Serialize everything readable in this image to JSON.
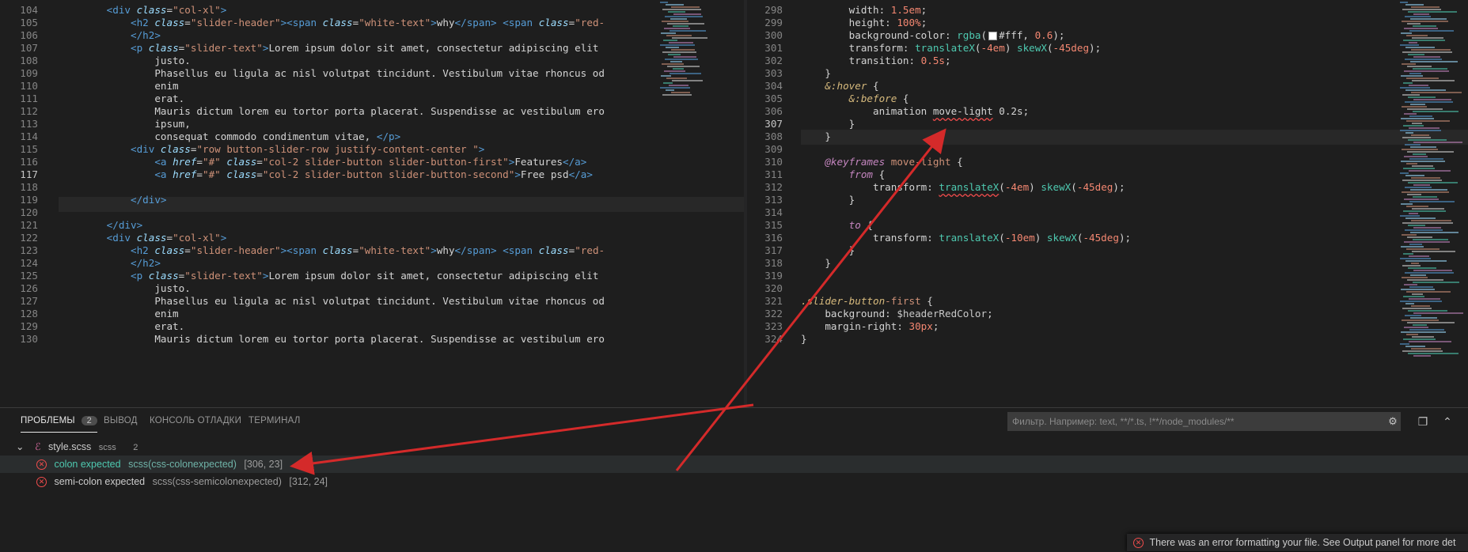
{
  "left_editor": {
    "lines": [
      {
        "n": "104",
        "parts": [
          [
            "txt",
            "        "
          ],
          [
            "tag",
            "<div "
          ],
          [
            "attr",
            "class"
          ],
          [
            "txt",
            "="
          ],
          [
            "str",
            "\"col-xl\""
          ],
          [
            "tag",
            ">"
          ]
        ]
      },
      {
        "n": "105",
        "parts": [
          [
            "txt",
            "            "
          ],
          [
            "tag",
            "<h2 "
          ],
          [
            "attr",
            "class"
          ],
          [
            "txt",
            "="
          ],
          [
            "str",
            "\"slider-header\""
          ],
          [
            "tag",
            "><span "
          ],
          [
            "attr",
            "class"
          ],
          [
            "txt",
            "="
          ],
          [
            "str",
            "\"white-text\""
          ],
          [
            "tag",
            ">"
          ],
          [
            "txt",
            "why"
          ],
          [
            "tag",
            "</span> <span "
          ],
          [
            "attr",
            "class"
          ],
          [
            "txt",
            "="
          ],
          [
            "str",
            "\"red-"
          ]
        ]
      },
      {
        "n": "106",
        "parts": [
          [
            "txt",
            "            "
          ],
          [
            "tag",
            "</h2>"
          ]
        ]
      },
      {
        "n": "107",
        "parts": [
          [
            "txt",
            "            "
          ],
          [
            "tag",
            "<p "
          ],
          [
            "attr",
            "class"
          ],
          [
            "txt",
            "="
          ],
          [
            "str",
            "\"slider-text\""
          ],
          [
            "tag",
            ">"
          ],
          [
            "txt",
            "Lorem ipsum dolor sit amet, consectetur adipiscing elit"
          ]
        ]
      },
      {
        "n": "108",
        "parts": [
          [
            "txt",
            "                justo."
          ]
        ]
      },
      {
        "n": "109",
        "parts": [
          [
            "txt",
            "                Phasellus eu ligula ac nisl volutpat tincidunt. Vestibulum vitae rhoncus od"
          ]
        ]
      },
      {
        "n": "110",
        "parts": [
          [
            "txt",
            "                enim"
          ]
        ]
      },
      {
        "n": "111",
        "parts": [
          [
            "txt",
            "                erat."
          ]
        ]
      },
      {
        "n": "112",
        "parts": [
          [
            "txt",
            "                Mauris dictum lorem eu tortor porta placerat. Suspendisse ac vestibulum ero"
          ]
        ]
      },
      {
        "n": "113",
        "parts": [
          [
            "txt",
            "                ipsum,"
          ]
        ]
      },
      {
        "n": "114",
        "parts": [
          [
            "txt",
            "                consequat commodo condimentum vitae, "
          ],
          [
            "tag",
            "</p>"
          ]
        ]
      },
      {
        "n": "115",
        "parts": [
          [
            "txt",
            "            "
          ],
          [
            "tag",
            "<div "
          ],
          [
            "attr",
            "class"
          ],
          [
            "txt",
            "="
          ],
          [
            "str",
            "\"row button-slider-row justify-content-center \""
          ],
          [
            "tag",
            ">"
          ]
        ]
      },
      {
        "n": "116",
        "parts": [
          [
            "txt",
            "                "
          ],
          [
            "tag",
            "<a "
          ],
          [
            "attr",
            "href"
          ],
          [
            "txt",
            "="
          ],
          [
            "str",
            "\"#\""
          ],
          [
            "txt",
            " "
          ],
          [
            "attr",
            "class"
          ],
          [
            "txt",
            "="
          ],
          [
            "str",
            "\"col-2 slider-button slider-button-first\""
          ],
          [
            "tag",
            ">"
          ],
          [
            "txt",
            "Features"
          ],
          [
            "tag",
            "</a>"
          ]
        ]
      },
      {
        "n": "117",
        "parts": [
          [
            "txt",
            "                "
          ],
          [
            "tag",
            "<a "
          ],
          [
            "attr",
            "href"
          ],
          [
            "txt",
            "="
          ],
          [
            "str",
            "\"#\""
          ],
          [
            "txt",
            " "
          ],
          [
            "attr",
            "class"
          ],
          [
            "txt",
            "="
          ],
          [
            "str",
            "\"col-2 slider-button slider-button-second\""
          ],
          [
            "tag",
            ">"
          ],
          [
            "txt",
            "Free psd"
          ],
          [
            "tag",
            "</a>"
          ]
        ]
      },
      {
        "n": "118",
        "parts": []
      },
      {
        "n": "119",
        "parts": [
          [
            "txt",
            "            "
          ],
          [
            "tag",
            "</div>"
          ]
        ]
      },
      {
        "n": "120",
        "parts": []
      },
      {
        "n": "121",
        "parts": [
          [
            "txt",
            "        "
          ],
          [
            "tag",
            "</div>"
          ]
        ]
      },
      {
        "n": "122",
        "parts": [
          [
            "txt",
            "        "
          ],
          [
            "tag",
            "<div "
          ],
          [
            "attr",
            "class"
          ],
          [
            "txt",
            "="
          ],
          [
            "str",
            "\"col-xl\""
          ],
          [
            "tag",
            ">"
          ]
        ]
      },
      {
        "n": "123",
        "parts": [
          [
            "txt",
            "            "
          ],
          [
            "tag",
            "<h2 "
          ],
          [
            "attr",
            "class"
          ],
          [
            "txt",
            "="
          ],
          [
            "str",
            "\"slider-header\""
          ],
          [
            "tag",
            "><span "
          ],
          [
            "attr",
            "class"
          ],
          [
            "txt",
            "="
          ],
          [
            "str",
            "\"white-text\""
          ],
          [
            "tag",
            ">"
          ],
          [
            "txt",
            "why"
          ],
          [
            "tag",
            "</span> <span "
          ],
          [
            "attr",
            "class"
          ],
          [
            "txt",
            "="
          ],
          [
            "str",
            "\"red-"
          ]
        ]
      },
      {
        "n": "124",
        "parts": [
          [
            "txt",
            "            "
          ],
          [
            "tag",
            "</h2>"
          ]
        ]
      },
      {
        "n": "125",
        "parts": [
          [
            "txt",
            "            "
          ],
          [
            "tag",
            "<p "
          ],
          [
            "attr",
            "class"
          ],
          [
            "txt",
            "="
          ],
          [
            "str",
            "\"slider-text\""
          ],
          [
            "tag",
            ">"
          ],
          [
            "txt",
            "Lorem ipsum dolor sit amet, consectetur adipiscing elit"
          ]
        ]
      },
      {
        "n": "126",
        "parts": [
          [
            "txt",
            "                justo."
          ]
        ]
      },
      {
        "n": "127",
        "parts": [
          [
            "txt",
            "                Phasellus eu ligula ac nisl volutpat tincidunt. Vestibulum vitae rhoncus od"
          ]
        ]
      },
      {
        "n": "128",
        "parts": [
          [
            "txt",
            "                enim"
          ]
        ]
      },
      {
        "n": "129",
        "parts": [
          [
            "txt",
            "                erat."
          ]
        ]
      },
      {
        "n": "130",
        "parts": [
          [
            "txt",
            "                Mauris dictum lorem eu tortor porta placerat. Suspendisse ac vestibulum ero"
          ]
        ]
      }
    ],
    "active_line": "117"
  },
  "right_editor": {
    "lines": [
      {
        "n": "298",
        "parts": [
          [
            "txt",
            "        "
          ],
          [
            "prop",
            "width: "
          ],
          [
            "num",
            "1.5em"
          ],
          [
            "txt",
            ";"
          ]
        ]
      },
      {
        "n": "299",
        "parts": [
          [
            "txt",
            "        "
          ],
          [
            "prop",
            "height: "
          ],
          [
            "num",
            "100%"
          ],
          [
            "txt",
            ";"
          ]
        ]
      },
      {
        "n": "300",
        "parts": [
          [
            "txt",
            "        "
          ],
          [
            "prop",
            "background-color: "
          ],
          [
            "fn",
            "rgba"
          ],
          [
            "txt",
            "("
          ],
          [
            "swatch",
            ""
          ],
          [
            "txt",
            "#fff, "
          ],
          [
            "num",
            "0.6"
          ],
          [
            "txt",
            ");"
          ]
        ]
      },
      {
        "n": "301",
        "parts": [
          [
            "txt",
            "        "
          ],
          [
            "prop",
            "transform: "
          ],
          [
            "fn",
            "translateX"
          ],
          [
            "txt",
            "("
          ],
          [
            "num",
            "-4em"
          ],
          [
            "txt",
            ") "
          ],
          [
            "fn",
            "skewX"
          ],
          [
            "txt",
            "("
          ],
          [
            "num",
            "-45deg"
          ],
          [
            "txt",
            ");"
          ]
        ]
      },
      {
        "n": "302",
        "parts": [
          [
            "txt",
            "        "
          ],
          [
            "prop",
            "transition: "
          ],
          [
            "num",
            "0.5s"
          ],
          [
            "txt",
            ";"
          ]
        ]
      },
      {
        "n": "303",
        "parts": [
          [
            "txt",
            "    }"
          ]
        ]
      },
      {
        "n": "304",
        "parts": [
          [
            "txt",
            "    "
          ],
          [
            "sel",
            "&:hover"
          ],
          [
            "txt",
            " {"
          ]
        ]
      },
      {
        "n": "305",
        "parts": [
          [
            "txt",
            "        "
          ],
          [
            "sel",
            "&:before"
          ],
          [
            "txt",
            " {"
          ]
        ]
      },
      {
        "n": "306",
        "parts": [
          [
            "txt",
            "            "
          ],
          [
            "prop",
            "animation "
          ],
          [
            "errstr",
            "move-light"
          ],
          [
            "txt",
            " 0.2s;"
          ]
        ]
      },
      {
        "n": "307",
        "parts": [
          [
            "txt",
            "        }"
          ]
        ]
      },
      {
        "n": "308",
        "parts": [
          [
            "txt",
            "    }"
          ]
        ]
      },
      {
        "n": "309",
        "parts": []
      },
      {
        "n": "310",
        "parts": [
          [
            "txt",
            "    "
          ],
          [
            "kw",
            "@keyframes"
          ],
          [
            "txt",
            " "
          ],
          [
            "str",
            "move-light"
          ],
          [
            "txt",
            " {"
          ]
        ]
      },
      {
        "n": "311",
        "parts": [
          [
            "txt",
            "        "
          ],
          [
            "kw",
            "from"
          ],
          [
            "txt",
            " {"
          ]
        ]
      },
      {
        "n": "312",
        "parts": [
          [
            "txt",
            "            "
          ],
          [
            "prop",
            "transform: "
          ],
          [
            "errfn",
            "translateX"
          ],
          [
            "txt",
            "("
          ],
          [
            "num",
            "-4em"
          ],
          [
            "txt",
            ") "
          ],
          [
            "fn",
            "skewX"
          ],
          [
            "txt",
            "("
          ],
          [
            "num",
            "-45deg"
          ],
          [
            "txt",
            ");"
          ]
        ]
      },
      {
        "n": "313",
        "parts": [
          [
            "txt",
            "        }"
          ]
        ]
      },
      {
        "n": "314",
        "parts": []
      },
      {
        "n": "315",
        "parts": [
          [
            "txt",
            "        "
          ],
          [
            "kw",
            "to"
          ],
          [
            "txt",
            " {"
          ]
        ]
      },
      {
        "n": "316",
        "parts": [
          [
            "txt",
            "            "
          ],
          [
            "prop",
            "transform: "
          ],
          [
            "fn",
            "translateX"
          ],
          [
            "txt",
            "("
          ],
          [
            "num",
            "-10em"
          ],
          [
            "txt",
            ") "
          ],
          [
            "fn",
            "skewX"
          ],
          [
            "txt",
            "("
          ],
          [
            "num",
            "-45deg"
          ],
          [
            "txt",
            ");"
          ]
        ]
      },
      {
        "n": "317",
        "parts": [
          [
            "txt",
            "        }"
          ]
        ]
      },
      {
        "n": "318",
        "parts": [
          [
            "txt",
            "    }"
          ]
        ]
      },
      {
        "n": "319",
        "parts": []
      },
      {
        "n": "320",
        "parts": []
      },
      {
        "n": "321",
        "parts": [
          [
            "sel",
            ".slider-button"
          ],
          [
            "str",
            "-first"
          ],
          [
            "txt",
            " {"
          ]
        ]
      },
      {
        "n": "322",
        "parts": [
          [
            "txt",
            "    "
          ],
          [
            "prop",
            "background: "
          ],
          [
            "var",
            "$headerRedColor"
          ],
          [
            "txt",
            ";"
          ]
        ]
      },
      {
        "n": "323",
        "parts": [
          [
            "txt",
            "    "
          ],
          [
            "prop",
            "margin-right: "
          ],
          [
            "num",
            "30px"
          ],
          [
            "txt",
            ";"
          ]
        ]
      },
      {
        "n": "324",
        "parts": [
          [
            "txt",
            "}"
          ]
        ]
      }
    ],
    "active_line": "307"
  },
  "panel": {
    "tabs": [
      {
        "label": "ПРОБЛЕМЫ",
        "badge": "2"
      },
      {
        "label": "ВЫВОД"
      },
      {
        "label": "КОНСОЛЬ ОТЛАДКИ"
      },
      {
        "label": "ТЕРМИНАЛ"
      }
    ],
    "filter_placeholder": "Фильтр. Например: text, **/*.ts, !**/node_modules/**",
    "file": {
      "name": "style.scss",
      "lang": "scss",
      "count": "2"
    },
    "problems": [
      {
        "message": "colon expected",
        "source": "scss(css-colonexpected)",
        "pos": "[306, 23]"
      },
      {
        "message": "semi-colon expected",
        "source": "scss(css-semicolonexpected)",
        "pos": "[312, 24]"
      }
    ]
  },
  "toast": {
    "message": "There was an error formatting your file. See Output panel for more det"
  },
  "colors": {
    "arrow": "#d42a2a",
    "error": "#f14c4c",
    "accent": "#007acc"
  }
}
